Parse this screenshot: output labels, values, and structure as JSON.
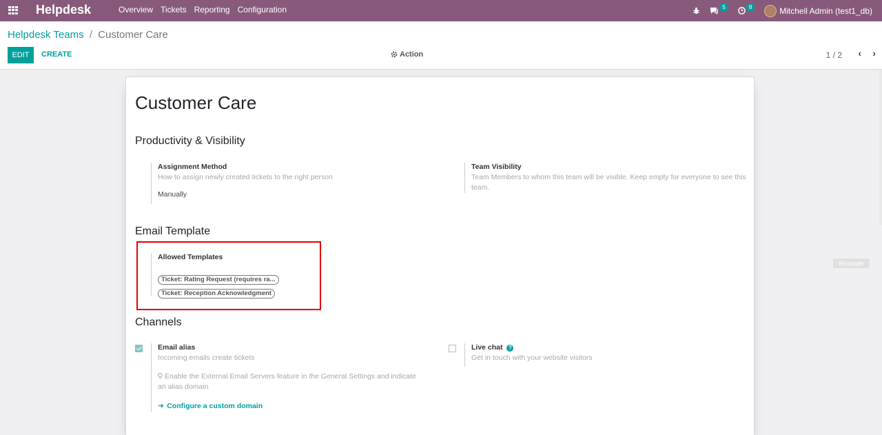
{
  "navbar": {
    "brand": "Helpdesk",
    "menu": [
      "Overview",
      "Tickets",
      "Reporting",
      "Configuration"
    ],
    "messages_count": "5",
    "activities_count": "8",
    "user": "Mitchell Admin (test1_db)"
  },
  "breadcrumb": {
    "parent": "Helpdesk Teams",
    "separator": "/",
    "current": "Customer Care"
  },
  "toolbar": {
    "edit": "EDIT",
    "create": "CREATE",
    "action": "Action",
    "pager": "1 / 2"
  },
  "form": {
    "title": "Customer Care",
    "productivity": {
      "title": "Productivity & Visibility",
      "assignment_label": "Assignment Method",
      "assignment_help": "How to assign newly created tickets to the right person",
      "assignment_value": "Manually",
      "visibility_label": "Team Visibility",
      "visibility_help": "Team Members to whom this team will be visible. Keep empty for everyone to see this team."
    },
    "email_template": {
      "title": "Email Template",
      "allowed_label": "Allowed Templates",
      "tags": [
        "Ticket: Rating Request (requires ra...",
        "Ticket: Reception Acknowledgment"
      ]
    },
    "channels": {
      "title": "Channels",
      "email_alias_label": "Email alias",
      "email_alias_help": "Incoming emails create tickets",
      "email_alias_hint": "Enable the External Email Servers feature in the General Settings and indicate an alias domain",
      "configure_link": "Configure a custom domain",
      "live_chat_label": "Live chat",
      "live_chat_help": "Get in touch with your website visitors"
    }
  },
  "overlay_label": "Rectangle",
  "colors": {
    "navbar": "#875a7b",
    "accent": "#00a09d",
    "highlight": "#e30000"
  }
}
